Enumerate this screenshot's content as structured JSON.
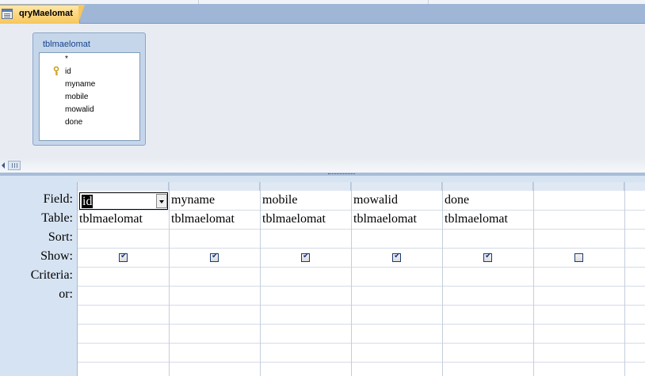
{
  "tab": {
    "title": "qryMaelomat",
    "icon": "query-icon"
  },
  "table_box": {
    "title": "tblmaelomat",
    "fields": [
      "*",
      "id",
      "myname",
      "mobile",
      "mowalid",
      "done"
    ],
    "primary_key": "id"
  },
  "grid": {
    "row_labels": [
      "Field:",
      "Table:",
      "Sort:",
      "Show:",
      "Criteria:",
      "or:"
    ],
    "columns": [
      {
        "field": "id",
        "table": "tblmaelomat",
        "show": true,
        "selected": true
      },
      {
        "field": "myname",
        "table": "tblmaelomat",
        "show": true
      },
      {
        "field": "mobile",
        "table": "tblmaelomat",
        "show": true
      },
      {
        "field": "mowalid",
        "table": "tblmaelomat",
        "show": true
      },
      {
        "field": "done",
        "table": "tblmaelomat",
        "show": true
      },
      {
        "field": "",
        "table": "",
        "show": false
      }
    ]
  },
  "colors": {
    "tab_active": "#f7c65c",
    "pane_bg": "#e8ecf2",
    "grid_label_bg": "#d6e3f2",
    "table_box_bg": "#c5d6ea"
  }
}
